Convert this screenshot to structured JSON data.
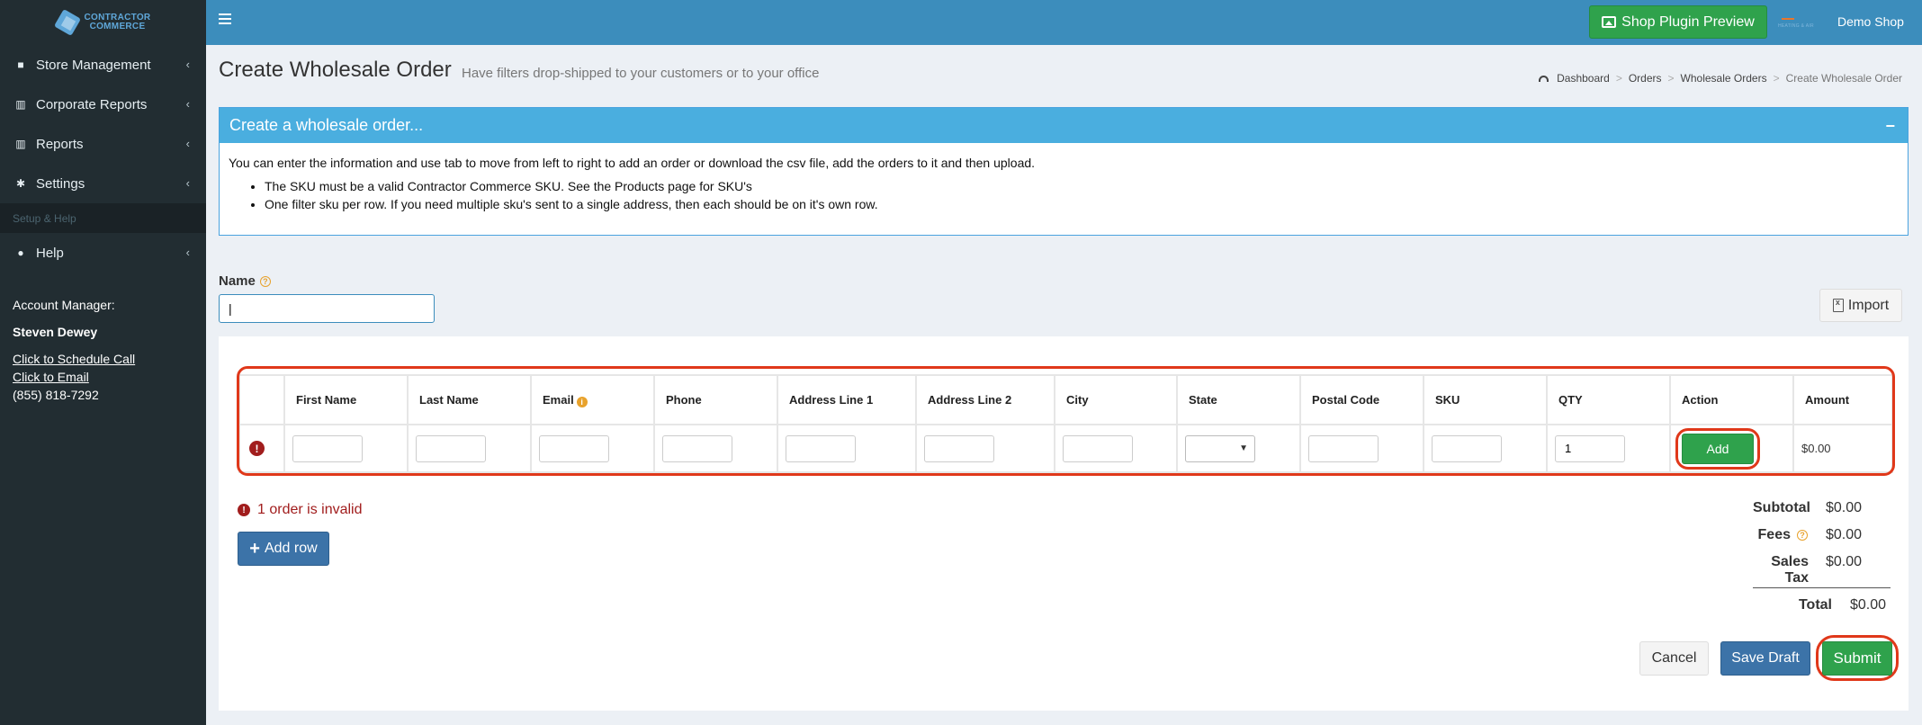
{
  "brand": {
    "logo_line1": "CONTRACTOR",
    "logo_line2": "COMMERCE"
  },
  "sidebar": {
    "items": [
      {
        "label": "Store Management",
        "icon": "truck-icon"
      },
      {
        "label": "Corporate Reports",
        "icon": "bar-chart-icon"
      },
      {
        "label": "Reports",
        "icon": "bar-chart-icon"
      },
      {
        "label": "Settings",
        "icon": "gear-icon"
      }
    ],
    "section_header": "Setup & Help",
    "help": {
      "label": "Help",
      "icon": "question-circle-icon"
    },
    "account": {
      "title": "Account Manager:",
      "name": "Steven Dewey",
      "schedule_link": "Click to Schedule Call",
      "email_link": "Click to Email",
      "phone": "(855) 818-7292"
    }
  },
  "topbar": {
    "plugin_button": "Shop Plugin Preview",
    "shop_logo_text": "HEATING & AIR",
    "shop_name": "Demo Shop"
  },
  "header": {
    "title": "Create Wholesale Order",
    "subtitle": "Have filters drop-shipped to your customers or to your office",
    "breadcrumb": [
      "Dashboard",
      "Orders",
      "Wholesale Orders",
      "Create Wholesale Order"
    ]
  },
  "info_box": {
    "title": "Create a wholesale order...",
    "collapse": "−",
    "intro": "You can enter the information and use tab to move from left to right to add an order or download the csv file, add the orders to it and then upload.",
    "bullets": [
      "The SKU must be a valid Contractor Commerce SKU. See the Products page for SKU's",
      "One filter sku per row. If you need multiple sku's sent to a single address, then each should be on it's own row."
    ]
  },
  "form": {
    "name_label": "Name",
    "name_value": "|",
    "import_button": "Import"
  },
  "table": {
    "headers": [
      "First Name",
      "Last Name",
      "Email",
      "Phone",
      "Address Line 1",
      "Address Line 2",
      "City",
      "State",
      "Postal Code",
      "SKU",
      "QTY",
      "Action",
      "Amount"
    ],
    "row": {
      "qty": "1",
      "action_label": "Add",
      "amount": "$0.00"
    }
  },
  "status": {
    "invalid_message": "1 order is invalid",
    "add_row_button": "Add row"
  },
  "totals": {
    "subtotal_label": "Subtotal",
    "subtotal_value": "$0.00",
    "fees_label": "Fees",
    "fees_value": "$0.00",
    "tax_label": "Sales Tax",
    "tax_value": "$0.00",
    "total_label": "Total",
    "total_value": "$0.00"
  },
  "actions": {
    "cancel": "Cancel",
    "save_draft": "Save Draft",
    "submit": "Submit"
  },
  "colors": {
    "sidebar_bg": "#222d32",
    "topbar_bg": "#3c8dbc",
    "info_header": "#4aaedf",
    "primary_green": "#2fa24c",
    "primary_blue": "#3c73a8",
    "error_red": "#a11d1d",
    "annotation_red": "#e0381a"
  }
}
